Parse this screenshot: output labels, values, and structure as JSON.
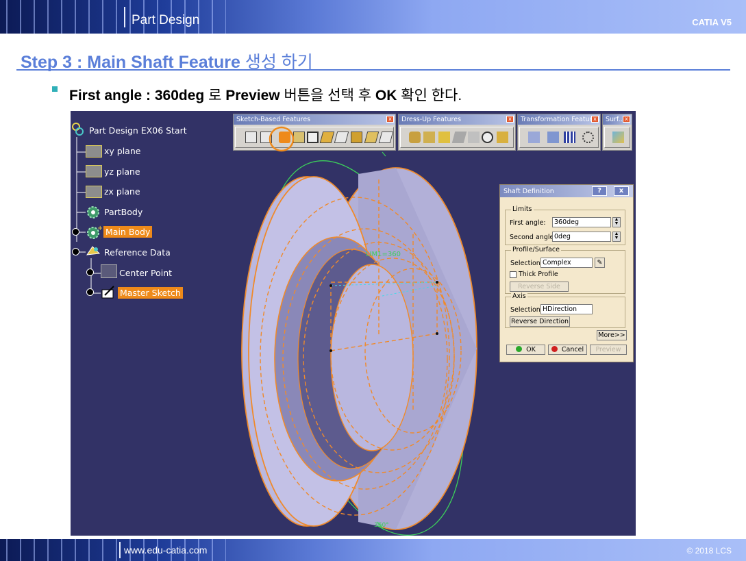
{
  "header": {
    "title": "Part Design",
    "product": "CATIA V5"
  },
  "step": {
    "title_bold": "Step 3 : Main Shaft Feature",
    "title_korean": "생성 하기"
  },
  "instruction": {
    "part1": "First angle : 360deg",
    "part2": "로",
    "part3": "Preview",
    "part4": "버튼을 선택 후",
    "part5": "OK",
    "part6": "확인 한다."
  },
  "tree": {
    "root": "Part Design EX06 Start",
    "items": [
      "xy plane",
      "yz plane",
      "zx plane",
      "PartBody",
      "Main Body",
      "Reference Data",
      "Center Point",
      "Master Sketch"
    ]
  },
  "toolbars": {
    "sketch_based": "Sketch-Based Features",
    "dress_up": "Dress-Up Features",
    "transformation": "Transformation Features",
    "surface": "Surf..."
  },
  "scene_labels": {
    "limit": "LIM1=360",
    "limit_bottom": "360°"
  },
  "dialog": {
    "title": "Shaft Definition",
    "help": "?",
    "close": "x",
    "limits_label": "Limits",
    "first_angle_label": "First angle:",
    "first_angle_value": "360deg",
    "second_angle_label": "Second angle:",
    "second_angle_value": "0deg",
    "profile_label": "Profile/Surface",
    "selection_label": "Selection:",
    "profile_selection": "Complex",
    "thick_profile": "Thick Profile",
    "reverse_side": "Reverse Side",
    "axis_label": "Axis",
    "axis_selection": "HDirection",
    "reverse_direction": "Reverse Direction",
    "more": "More>>",
    "ok": "OK",
    "cancel": "Cancel",
    "preview": "Preview"
  },
  "footer": {
    "website": "www.edu-catia.com",
    "copyright": "© 2018 LCS"
  },
  "colors": {
    "accent": "#5b7fd9",
    "selection": "#ee8a1a",
    "viewport_bg": "#323266",
    "edge": "#f08a2a"
  }
}
